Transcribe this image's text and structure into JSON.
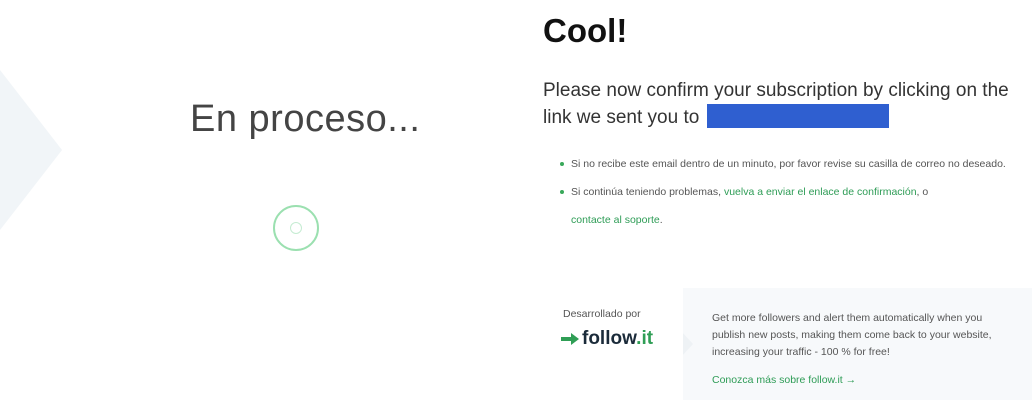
{
  "left": {
    "processing": "En proceso..."
  },
  "right": {
    "heading": "Cool!",
    "confirm_text": "Please now confirm your subscription by clicking on the link we sent you to",
    "notes": [
      {
        "text": "Si no recibe este email dentro de un minuto, por favor revise su casilla de correo no deseado."
      },
      {
        "prefix": "Si continúa teniendo problemas, ",
        "resend_link": "vuelva a enviar el enlace de confirmación",
        "middle": ", o ",
        "support_link": "contacte al soporte",
        "suffix": "."
      }
    ]
  },
  "footer": {
    "developed_by": "Desarrollado por",
    "brand_name": "follow",
    "brand_suffix": ".it",
    "promo": "Get more followers and alert them automatically when you publish new posts, making them come back to your website, increasing your traffic - 100 % for free!",
    "more_link": "Conozca más sobre follow.it →"
  },
  "colors": {
    "accent_green": "#2e9c56",
    "redaction_blue": "#2f5fd0"
  },
  "icons": [
    "spinner-icon",
    "follow-it-arrow-icon"
  ]
}
